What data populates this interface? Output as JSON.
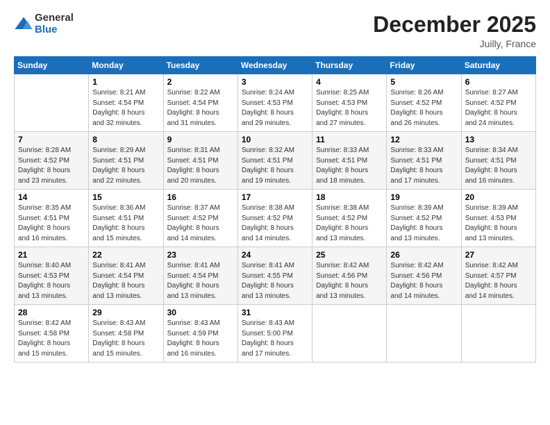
{
  "logo": {
    "general": "General",
    "blue": "Blue"
  },
  "title": "December 2025",
  "location": "Juilly, France",
  "days_of_week": [
    "Sunday",
    "Monday",
    "Tuesday",
    "Wednesday",
    "Thursday",
    "Friday",
    "Saturday"
  ],
  "weeks": [
    [
      {
        "day": "",
        "info": ""
      },
      {
        "day": "1",
        "info": "Sunrise: 8:21 AM\nSunset: 4:54 PM\nDaylight: 8 hours\nand 32 minutes."
      },
      {
        "day": "2",
        "info": "Sunrise: 8:22 AM\nSunset: 4:54 PM\nDaylight: 8 hours\nand 31 minutes."
      },
      {
        "day": "3",
        "info": "Sunrise: 8:24 AM\nSunset: 4:53 PM\nDaylight: 8 hours\nand 29 minutes."
      },
      {
        "day": "4",
        "info": "Sunrise: 8:25 AM\nSunset: 4:53 PM\nDaylight: 8 hours\nand 27 minutes."
      },
      {
        "day": "5",
        "info": "Sunrise: 8:26 AM\nSunset: 4:52 PM\nDaylight: 8 hours\nand 26 minutes."
      },
      {
        "day": "6",
        "info": "Sunrise: 8:27 AM\nSunset: 4:52 PM\nDaylight: 8 hours\nand 24 minutes."
      }
    ],
    [
      {
        "day": "7",
        "info": "Sunrise: 8:28 AM\nSunset: 4:52 PM\nDaylight: 8 hours\nand 23 minutes."
      },
      {
        "day": "8",
        "info": "Sunrise: 8:29 AM\nSunset: 4:51 PM\nDaylight: 8 hours\nand 22 minutes."
      },
      {
        "day": "9",
        "info": "Sunrise: 8:31 AM\nSunset: 4:51 PM\nDaylight: 8 hours\nand 20 minutes."
      },
      {
        "day": "10",
        "info": "Sunrise: 8:32 AM\nSunset: 4:51 PM\nDaylight: 8 hours\nand 19 minutes."
      },
      {
        "day": "11",
        "info": "Sunrise: 8:33 AM\nSunset: 4:51 PM\nDaylight: 8 hours\nand 18 minutes."
      },
      {
        "day": "12",
        "info": "Sunrise: 8:33 AM\nSunset: 4:51 PM\nDaylight: 8 hours\nand 17 minutes."
      },
      {
        "day": "13",
        "info": "Sunrise: 8:34 AM\nSunset: 4:51 PM\nDaylight: 8 hours\nand 16 minutes."
      }
    ],
    [
      {
        "day": "14",
        "info": "Sunrise: 8:35 AM\nSunset: 4:51 PM\nDaylight: 8 hours\nand 16 minutes."
      },
      {
        "day": "15",
        "info": "Sunrise: 8:36 AM\nSunset: 4:51 PM\nDaylight: 8 hours\nand 15 minutes."
      },
      {
        "day": "16",
        "info": "Sunrise: 8:37 AM\nSunset: 4:52 PM\nDaylight: 8 hours\nand 14 minutes."
      },
      {
        "day": "17",
        "info": "Sunrise: 8:38 AM\nSunset: 4:52 PM\nDaylight: 8 hours\nand 14 minutes."
      },
      {
        "day": "18",
        "info": "Sunrise: 8:38 AM\nSunset: 4:52 PM\nDaylight: 8 hours\nand 13 minutes."
      },
      {
        "day": "19",
        "info": "Sunrise: 8:39 AM\nSunset: 4:52 PM\nDaylight: 8 hours\nand 13 minutes."
      },
      {
        "day": "20",
        "info": "Sunrise: 8:39 AM\nSunset: 4:53 PM\nDaylight: 8 hours\nand 13 minutes."
      }
    ],
    [
      {
        "day": "21",
        "info": "Sunrise: 8:40 AM\nSunset: 4:53 PM\nDaylight: 8 hours\nand 13 minutes."
      },
      {
        "day": "22",
        "info": "Sunrise: 8:41 AM\nSunset: 4:54 PM\nDaylight: 8 hours\nand 13 minutes."
      },
      {
        "day": "23",
        "info": "Sunrise: 8:41 AM\nSunset: 4:54 PM\nDaylight: 8 hours\nand 13 minutes."
      },
      {
        "day": "24",
        "info": "Sunrise: 8:41 AM\nSunset: 4:55 PM\nDaylight: 8 hours\nand 13 minutes."
      },
      {
        "day": "25",
        "info": "Sunrise: 8:42 AM\nSunset: 4:56 PM\nDaylight: 8 hours\nand 13 minutes."
      },
      {
        "day": "26",
        "info": "Sunrise: 8:42 AM\nSunset: 4:56 PM\nDaylight: 8 hours\nand 14 minutes."
      },
      {
        "day": "27",
        "info": "Sunrise: 8:42 AM\nSunset: 4:57 PM\nDaylight: 8 hours\nand 14 minutes."
      }
    ],
    [
      {
        "day": "28",
        "info": "Sunrise: 8:42 AM\nSunset: 4:58 PM\nDaylight: 8 hours\nand 15 minutes."
      },
      {
        "day": "29",
        "info": "Sunrise: 8:43 AM\nSunset: 4:58 PM\nDaylight: 8 hours\nand 15 minutes."
      },
      {
        "day": "30",
        "info": "Sunrise: 8:43 AM\nSunset: 4:59 PM\nDaylight: 8 hours\nand 16 minutes."
      },
      {
        "day": "31",
        "info": "Sunrise: 8:43 AM\nSunset: 5:00 PM\nDaylight: 8 hours\nand 17 minutes."
      },
      {
        "day": "",
        "info": ""
      },
      {
        "day": "",
        "info": ""
      },
      {
        "day": "",
        "info": ""
      }
    ]
  ]
}
